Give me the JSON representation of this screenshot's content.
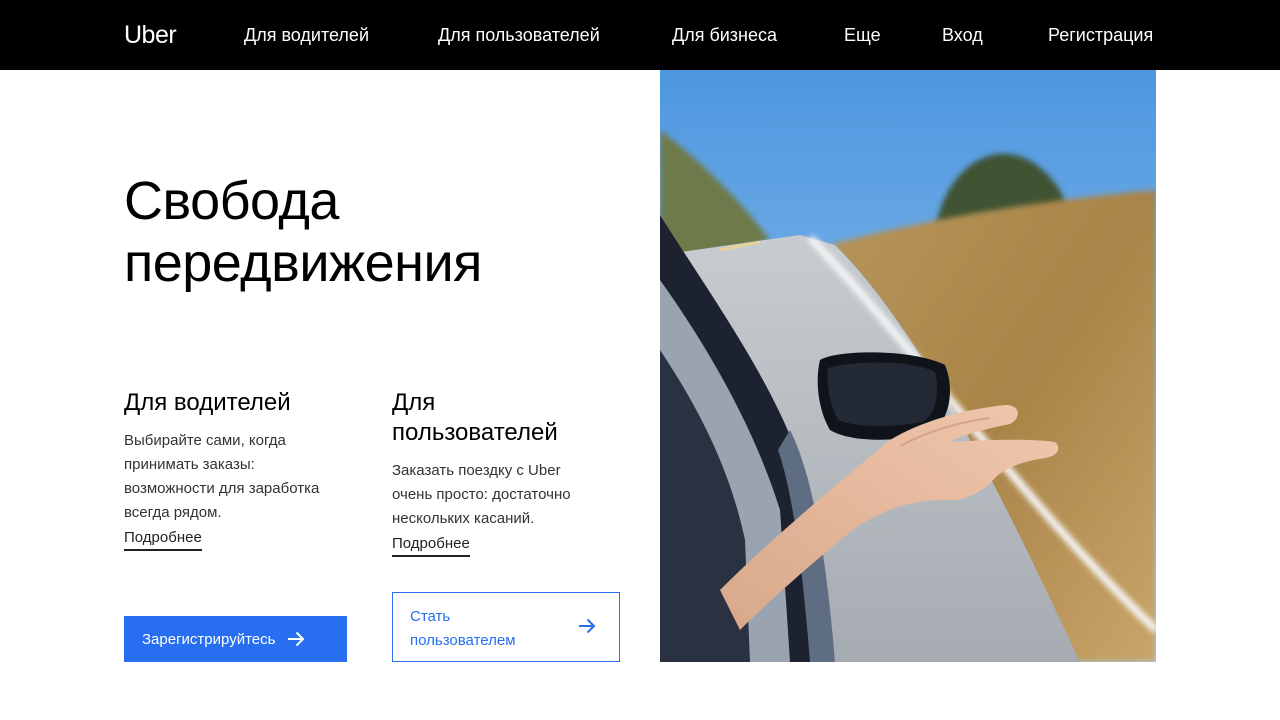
{
  "header": {
    "logo": "Uber",
    "nav": [
      {
        "label": "Для водителей"
      },
      {
        "label": "Для пользователей"
      },
      {
        "label": "Для бизнеса"
      },
      {
        "label": "Еще"
      },
      {
        "label": "Вход"
      },
      {
        "label": "Регистрация"
      }
    ]
  },
  "hero": {
    "title_line1": "Свобода",
    "title_line2": "передвижения"
  },
  "drivers": {
    "title": "Для водителей",
    "desc_lines": [
      "Выбирайте сами, когда",
      "принимать заказы:",
      "возможности для заработка",
      "всегда рядом."
    ],
    "link": "Подробнее",
    "button": "Зарегистрируйтесь"
  },
  "riders": {
    "title_line1": "Для",
    "title_line2": "пользователей",
    "desc_lines": [
      "Заказать поездку с Uber",
      "очень просто: достаточно",
      "нескольких касаний."
    ],
    "link": "Подробнее",
    "button_line1": "Стать",
    "button_line2": "пользователем"
  },
  "colors": {
    "accent": "#276ef1",
    "header_bg": "#000000",
    "text": "#000000"
  },
  "icons": {
    "button_arrow": "arrow-right-icon",
    "photo": "hand-out-car-window-photo"
  }
}
